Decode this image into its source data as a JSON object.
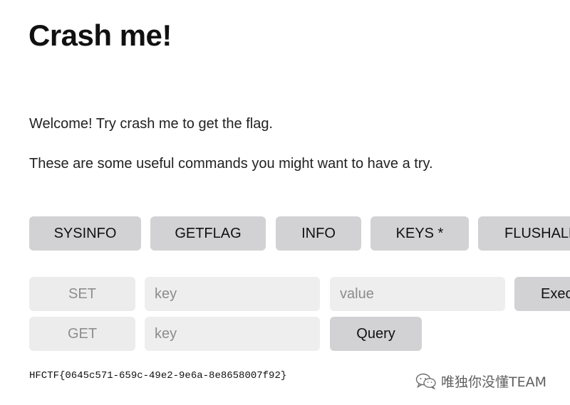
{
  "page": {
    "title": "Crash me!",
    "welcome_text": "Welcome! Try crash me to get the flag.",
    "hint_text": "These are some useful commands you might want to have a try."
  },
  "commands": {
    "sysinfo": "SYSINFO",
    "getflag": "GETFLAG",
    "info": "INFO",
    "keys": "KEYS *",
    "flushall": "FLUSHALL"
  },
  "set_row": {
    "label": "SET",
    "key_placeholder": "key",
    "value_placeholder": "value",
    "execute_label": "Execute"
  },
  "get_row": {
    "label": "GET",
    "key_placeholder": "key",
    "query_label": "Query"
  },
  "flag": "HFCTF{0645c571-659c-49e2-9e6a-8e8658007f92}",
  "watermark": {
    "icon": "wechat-icon",
    "text": "唯独你没懂TEAM"
  }
}
